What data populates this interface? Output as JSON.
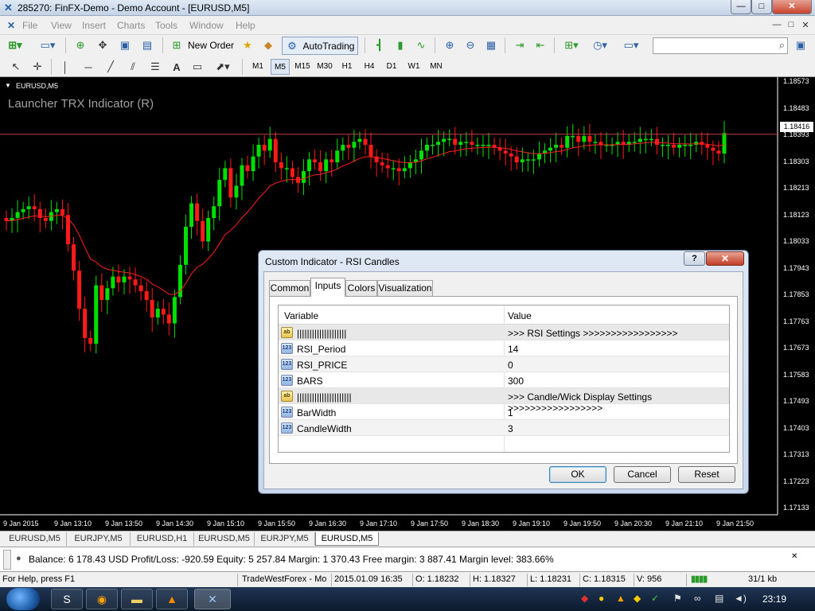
{
  "window": {
    "title": "285270: FinFX-Demo - Demo Account - [EURUSD,M5]",
    "min_glyph": "—",
    "max_glyph": "□",
    "close_glyph": "✕"
  },
  "menu": {
    "items": [
      "File",
      "View",
      "Insert",
      "Charts",
      "Tools",
      "Window",
      "Help"
    ],
    "mdi": [
      "—",
      "□",
      "✕"
    ]
  },
  "toolbar": {
    "new_order": "New Order",
    "autotrading": "AutoTrading",
    "timeframes": [
      "M1",
      "M5",
      "M15",
      "M30",
      "H1",
      "H4",
      "D1",
      "W1",
      "MN"
    ],
    "active_timeframe": "M5",
    "search_placeholder": ""
  },
  "chart": {
    "symbol_label": "EURUSD,M5",
    "indicator_label": "Launcher TRX Indicator (R)",
    "price_tag": "1.18416",
    "y_ticks": [
      "1.18573",
      "1.18483",
      "1.18393",
      "1.18303",
      "1.18213",
      "1.18123",
      "1.18033",
      "1.17943",
      "1.17853",
      "1.17763",
      "1.17673",
      "1.17583",
      "1.17493",
      "1.17403",
      "1.17313",
      "1.17223",
      "1.17133"
    ],
    "x_ticks": [
      "9 Jan 2015",
      "9 Jan 13:10",
      "9 Jan 13:50",
      "9 Jan 14:30",
      "9 Jan 15:10",
      "9 Jan 15:50",
      "9 Jan 16:30",
      "9 Jan 17:10",
      "9 Jan 17:50",
      "9 Jan 18:30",
      "9 Jan 19:10",
      "9 Jan 19:50",
      "9 Jan 20:30",
      "9 Jan 21:10",
      "9 Jan 21:50"
    ],
    "colors": {
      "bull": "#00e000",
      "bear": "#ff1a1a",
      "ma": "#ff2020",
      "background": "#000000",
      "price_line": "#c04040"
    }
  },
  "chart_data": {
    "type": "candlestick",
    "x_label": "",
    "y_label": "",
    "ylim": [
      1.1713,
      1.186
    ],
    "price_line": 1.18416,
    "closes": [
      1.1812,
      1.1813,
      1.1815,
      1.1816,
      1.1817,
      1.1816,
      1.1813,
      1.1812,
      1.1815,
      1.1816,
      1.1814,
      1.1804,
      1.1795,
      1.1782,
      1.1772,
      1.177,
      1.179,
      1.1785,
      1.1789,
      1.1793,
      1.1791,
      1.1793,
      1.1792,
      1.179,
      1.1788,
      1.1785,
      1.1779,
      1.1782,
      1.178,
      1.1777,
      1.1786,
      1.1797,
      1.181,
      1.1818,
      1.1812,
      1.1805,
      1.1813,
      1.1817,
      1.1826,
      1.183,
      1.182,
      1.1824,
      1.1831,
      1.1829,
      1.1834,
      1.1838,
      1.1836,
      1.184,
      1.1832,
      1.183,
      1.183,
      1.1827,
      1.1825,
      1.1829,
      1.1833,
      1.1832,
      1.1829,
      1.1833,
      1.1832,
      1.1836,
      1.1838,
      1.1837,
      1.1839,
      1.184,
      1.1838,
      1.1834,
      1.1832,
      1.1831,
      1.183,
      1.183,
      1.1829,
      1.183,
      1.1832,
      1.1833,
      1.1836,
      1.1838,
      1.1838,
      1.1839,
      1.184,
      1.184,
      1.1838,
      1.1839,
      1.1839,
      1.1838,
      1.1838,
      1.1838,
      1.1838,
      1.1837,
      1.1836,
      1.1835,
      1.1834,
      1.1832,
      1.1833,
      1.1833,
      1.1833,
      1.1835,
      1.1836,
      1.1837,
      1.1838,
      1.1837,
      1.1841,
      1.1841,
      1.1839,
      1.1841,
      1.1839,
      1.1839,
      1.1838,
      1.1838,
      1.1838,
      1.1839,
      1.1838,
      1.1839,
      1.1839,
      1.184,
      1.184,
      1.184,
      1.1838,
      1.1838,
      1.1838,
      1.1837,
      1.1838,
      1.1838,
      1.1838,
      1.1839,
      1.1838,
      1.1837,
      1.1836,
      1.1835,
      1.1842
    ]
  },
  "dialog": {
    "title": "Custom Indicator - RSI Candles",
    "help_glyph": "?",
    "close_glyph": "✕",
    "tabs": [
      "Common",
      "Inputs",
      "Colors",
      "Visualization"
    ],
    "active_tab": "Inputs",
    "columns": [
      "Variable",
      "Value"
    ],
    "rows": [
      {
        "type": "ab",
        "variable": "||||||||||||||||||||",
        "value": ">>> RSI Settings >>>>>>>>>>>>>>>>>"
      },
      {
        "type": "123",
        "variable": "RSI_Period",
        "value": "14"
      },
      {
        "type": "123",
        "variable": "RSI_PRICE",
        "value": "0"
      },
      {
        "type": "123",
        "variable": "BARS",
        "value": "300"
      },
      {
        "type": "ab",
        "variable": "||||||||||||||||||||||",
        "value": ">>> Candle/Wick Display Settings >>>>>>>>>>>>>>>>>"
      },
      {
        "type": "123",
        "variable": "BarWidth",
        "value": "1"
      },
      {
        "type": "123",
        "variable": "CandleWidth",
        "value": "3"
      }
    ],
    "ok": "OK",
    "cancel": "Cancel",
    "reset": "Reset"
  },
  "chart_tabs": [
    "EURUSD,M5",
    "EURJPY,M5",
    "EURUSD,H1",
    "EURUSD,M5",
    "EURJPY,M5",
    "EURUSD,M5"
  ],
  "active_chart_tab": 5,
  "terminal": {
    "balance_line": "Balance: 6 178.43 USD  Profit/Loss: -920.59  Equity: 5 257.84  Margin: 1 370.43  Free margin: 3 887.41  Margin level: 383.66%"
  },
  "statusbar": {
    "help": "For Help, press F1",
    "profile": "TradeWestForex - Mo",
    "datetime": "2015.01.09 16:35",
    "open": "O: 1.18232",
    "high": "H: 1.18327",
    "low": "L: 1.18231",
    "close": "C: 1.18315",
    "volume": "V: 956",
    "traffic": "31/1 kb"
  },
  "taskbar": {
    "clock": "23:19"
  }
}
